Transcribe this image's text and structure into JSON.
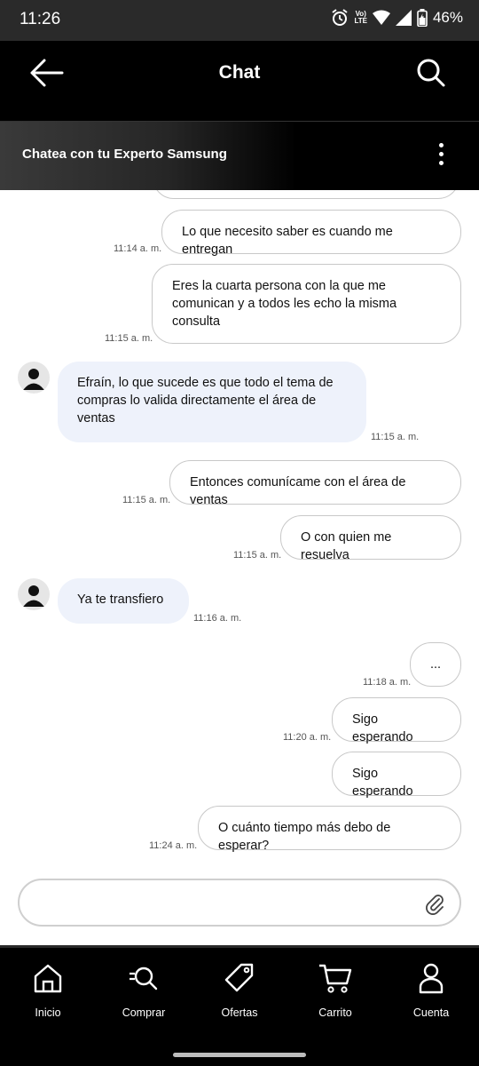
{
  "status": {
    "time": "11:26",
    "battery": "46%",
    "network": "Vo) LTE"
  },
  "header": {
    "title": "Chat"
  },
  "subheader": {
    "title": "Chatea con tu Experto Samsung"
  },
  "messages": [
    {
      "from": "user",
      "text": "Lo que necesito saber es cuando me entregan",
      "time": "11:14 a. m."
    },
    {
      "from": "user",
      "text": "Eres la cuarta persona con la que me comunican y a todos les echo la misma consulta",
      "time": "11:15 a. m."
    },
    {
      "from": "agent",
      "text": "Efraín, lo que sucede es que todo el tema de compras lo valida directamente el área de ventas",
      "time": "11:15 a. m."
    },
    {
      "from": "user",
      "text": "Entonces comunícame con el área de ventas",
      "time": "11:15 a. m."
    },
    {
      "from": "user",
      "text": "O con quien me resuelva",
      "time": "11:15 a. m."
    },
    {
      "from": "agent",
      "text": "Ya te transfiero",
      "time": "11:16 a. m."
    },
    {
      "from": "user",
      "text": "...",
      "time": "11:18 a. m."
    },
    {
      "from": "user",
      "text": "Sigo esperando",
      "time": "11:20 a. m."
    },
    {
      "from": "user",
      "text": "Sigo esperando",
      "time": ""
    },
    {
      "from": "user",
      "text": "O cuánto tiempo más debo de esperar?",
      "time": "11:24 a. m."
    }
  ],
  "input": {
    "placeholder": ""
  },
  "nav": [
    {
      "label": "Inicio",
      "icon": "home-icon"
    },
    {
      "label": "Comprar",
      "icon": "search-list-icon"
    },
    {
      "label": "Ofertas",
      "icon": "tag-icon"
    },
    {
      "label": "Carrito",
      "icon": "cart-icon"
    },
    {
      "label": "Cuenta",
      "icon": "person-icon"
    }
  ]
}
